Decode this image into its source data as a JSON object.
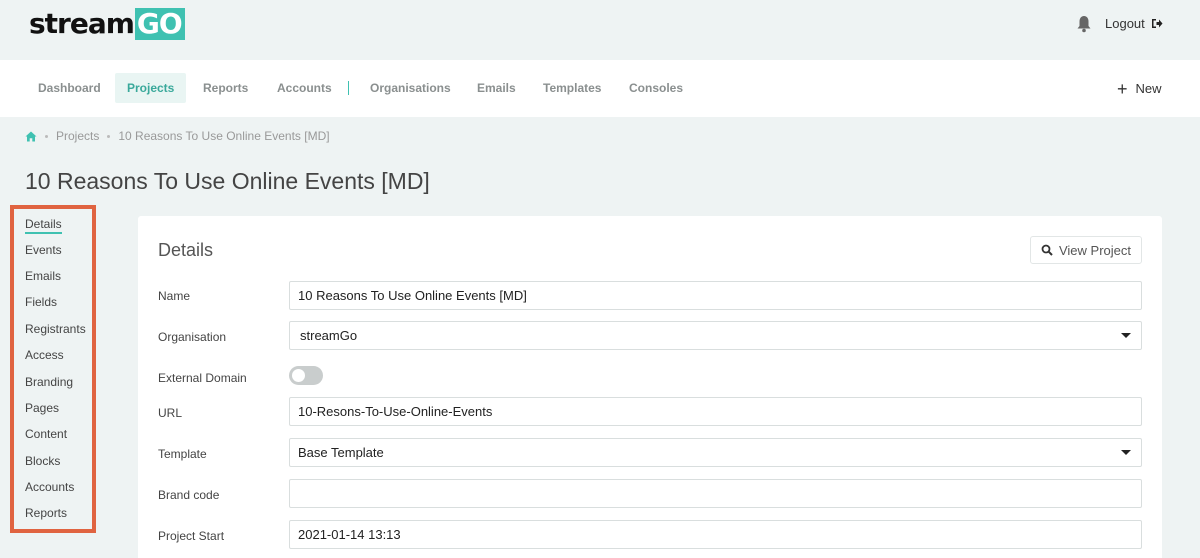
{
  "header": {
    "logo_text": "stream",
    "logo_box": "GO",
    "logout_label": "Logout"
  },
  "nav": {
    "items": [
      "Dashboard",
      "Projects",
      "Reports",
      "Accounts",
      "Organisations",
      "Emails",
      "Templates",
      "Consoles"
    ],
    "active": "Projects",
    "new_label": "New"
  },
  "breadcrumb": {
    "items": [
      "Projects",
      "10 Reasons To Use Online Events [MD]"
    ]
  },
  "page_title": "10 Reasons To Use Online Events [MD]",
  "sidebar": {
    "items": [
      "Details",
      "Events",
      "Emails",
      "Fields",
      "Registrants",
      "Access",
      "Branding",
      "Pages",
      "Content",
      "Blocks",
      "Accounts",
      "Reports"
    ],
    "active": "Details",
    "highlight_color": "#e06340"
  },
  "details": {
    "title": "Details",
    "view_project_label": "View Project",
    "name_label": "Name",
    "name_value": "10 Reasons To Use Online Events [MD]",
    "organisation_label": "Organisation",
    "organisation_value": "streamGo",
    "external_domain_label": "External Domain",
    "external_domain_enabled": false,
    "url_label": "URL",
    "url_value": "10-Resons-To-Use-Online-Events",
    "template_label": "Template",
    "template_value": "Base Template",
    "brand_code_label": "Brand code",
    "brand_code_value": "",
    "project_start_label": "Project Start",
    "project_start_value": "2021-01-14 13:13"
  },
  "colors": {
    "accent": "#3fc1b1",
    "sidebar_border": "#e06340"
  }
}
